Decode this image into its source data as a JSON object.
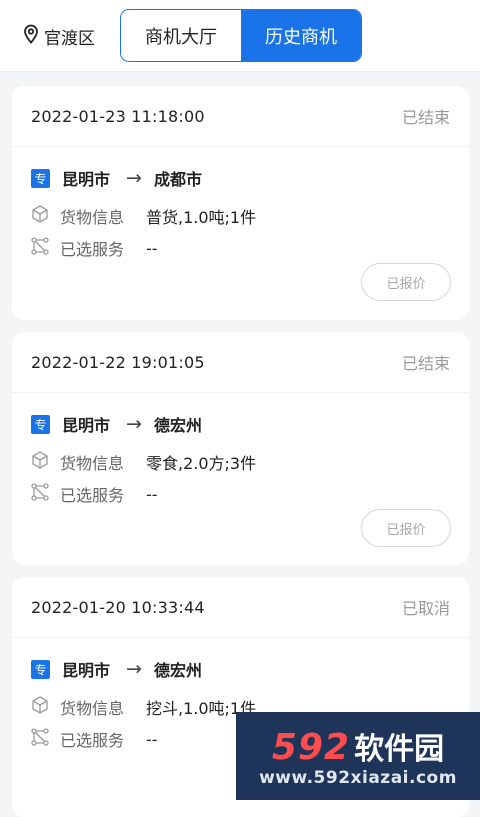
{
  "header": {
    "location": "官渡区",
    "tabs": [
      "商机大厅",
      "历史商机"
    ],
    "active_tab_index": 1
  },
  "labels": {
    "cargo": "货物信息",
    "service": "已选服务",
    "quoted": "已报价"
  },
  "orders": [
    {
      "time": "2022-01-23 11:18:00",
      "status": "已结束",
      "badge": "专",
      "from": "昆明市",
      "to": "成都市",
      "cargo": "普货,1.0吨;1件",
      "service": "--",
      "action": "已报价"
    },
    {
      "time": "2022-01-22 19:01:05",
      "status": "已结束",
      "badge": "专",
      "from": "昆明市",
      "to": "德宏州",
      "cargo": "零食,2.0方;3件",
      "service": "--",
      "action": "已报价"
    },
    {
      "time": "2022-01-20 10:33:44",
      "status": "已取消",
      "badge": "专",
      "from": "昆明市",
      "to": "德宏州",
      "cargo": "挖斗,1.0吨;1件",
      "service": "--"
    }
  ],
  "watermark": {
    "number": "592",
    "name": "软件园",
    "url": "www.592xiazai.com"
  },
  "colors": {
    "accent": "#1a73e8",
    "status": "#9a9a9a",
    "background": "#f4f5f7"
  }
}
